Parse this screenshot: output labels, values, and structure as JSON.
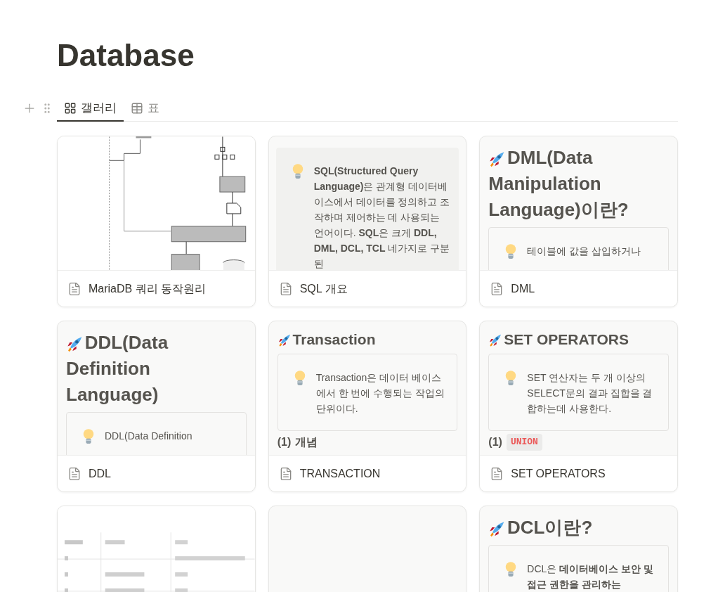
{
  "title": "Database",
  "tabs": [
    {
      "label": "갤러리",
      "selected": true
    },
    {
      "label": "표",
      "selected": false
    }
  ],
  "cards": [
    {
      "kind": "picture",
      "title": "MariaDB 쿼리 동작원리"
    },
    {
      "kind": "blocks",
      "title": "SQL 개요",
      "blocks": [
        {
          "kind": "callout",
          "filled": true,
          "text": "**SQL(Structured Query Language)**은 관계형 데이터베이스에서 데이터를 정의하고 조작하며 제어하는 데 사용되는 언어이다. **SQL**은 크게 **DDL, DML, DCL, TCL** 네가지로 구분된"
        }
      ]
    },
    {
      "kind": "blocks",
      "title": "DML",
      "blocks": [
        {
          "kind": "heading_1",
          "text": "DML(Data Manipulation Language)이란?"
        },
        {
          "kind": "callout",
          "filled": false,
          "text": "테이블에 값을 삽입하거나"
        }
      ]
    },
    {
      "kind": "blocks",
      "title": "DDL",
      "blocks": [
        {
          "kind": "heading_1",
          "text": "DDL(Data Definition Language)"
        },
        {
          "kind": "callout",
          "filled": false,
          "text": "DDL(Data Definition"
        }
      ]
    },
    {
      "kind": "blocks",
      "title": "TRANSACTION",
      "blocks": [
        {
          "kind": "heading_2",
          "text": "Transaction"
        },
        {
          "kind": "callout",
          "filled": false,
          "text": "Transaction은 데이터 베이스에서 한 번에 수행되는 작업의 단위이다."
        },
        {
          "kind": "numbered_heading",
          "number": "(1)",
          "text": "개념"
        }
      ]
    },
    {
      "kind": "blocks",
      "title": "SET OPERATORS",
      "blocks": [
        {
          "kind": "heading_2",
          "text": "SET OPERATORS"
        },
        {
          "kind": "callout",
          "filled": false,
          "text": "SET 연산자는 두 개 이상의 SELECT문의 결과 집합을 결합하는데 사용한다."
        },
        {
          "kind": "numbered_heading",
          "number": "(1)",
          "code": "UNION"
        }
      ]
    },
    {
      "kind": "picture"
    },
    {
      "kind": "blank"
    },
    {
      "kind": "blocks",
      "blocks": [
        {
          "kind": "heading_1",
          "text": "DCL이란?"
        },
        {
          "kind": "callout",
          "filled": false,
          "text": "DCL은 **데이터베이스 보안 및 접근 권한을 관리하는**"
        }
      ]
    }
  ]
}
